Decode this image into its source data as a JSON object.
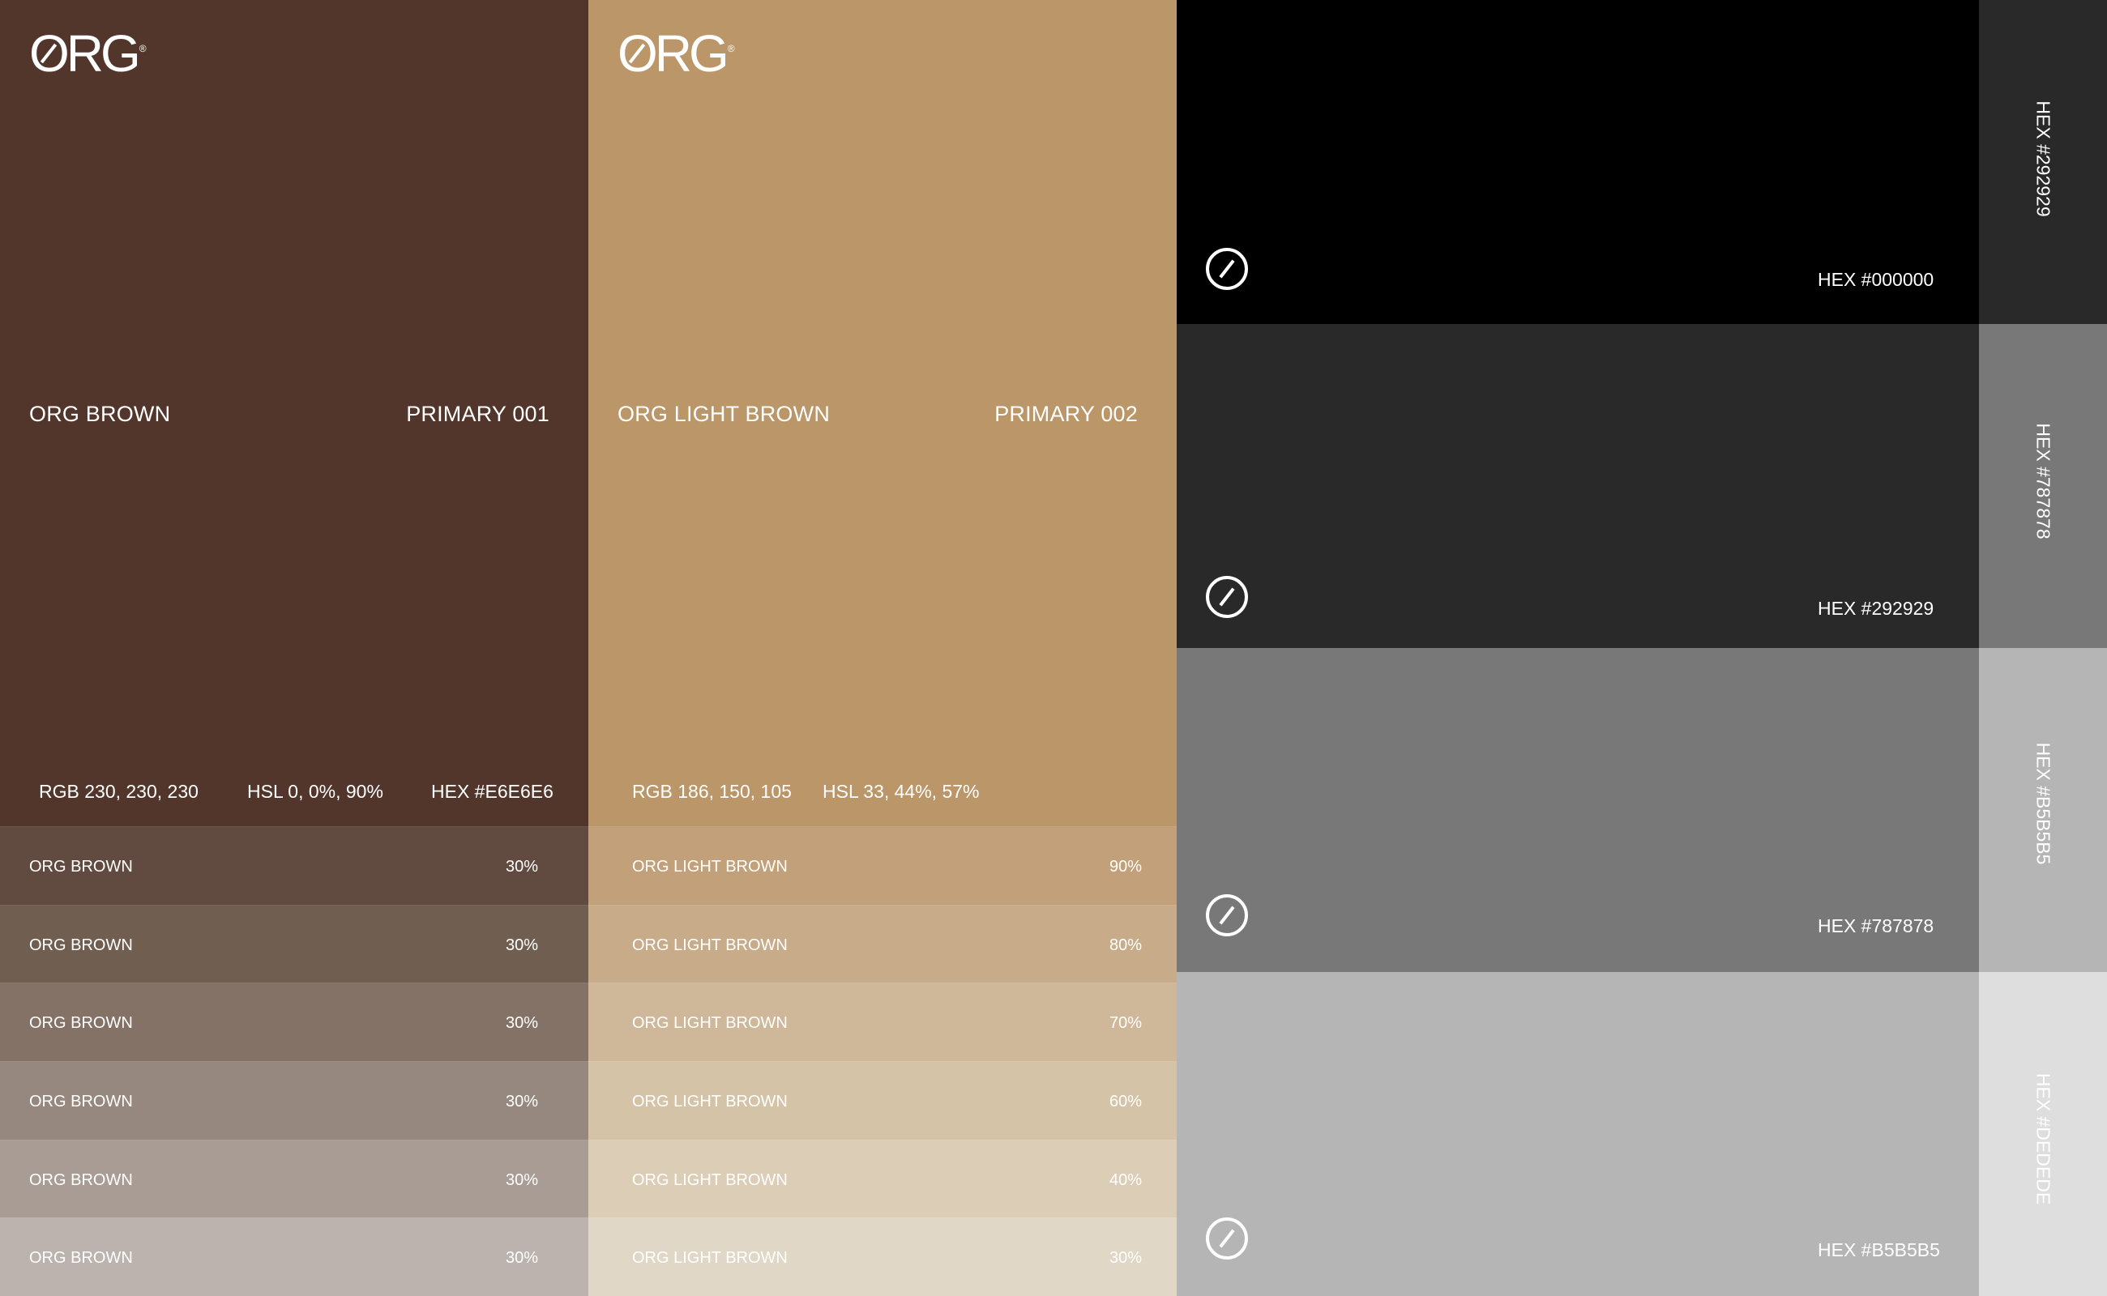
{
  "brown": {
    "logo_text": "ORG",
    "name": "ORG BROWN",
    "primary": "PRIMARY 001",
    "rgb": "RGB 230, 230, 230",
    "hsl": "HSL 0, 0%, 90%",
    "hex": "HEX #E6E6E6",
    "color": "#52362B",
    "tints": [
      {
        "label": "ORG BROWN",
        "pct": "30%",
        "color": "#614A3F"
      },
      {
        "label": "ORG BROWN",
        "pct": "30%",
        "color": "#705F51"
      },
      {
        "label": "ORG BROWN",
        "pct": "30%",
        "color": "#847267"
      },
      {
        "label": "ORG BROWN",
        "pct": "30%",
        "color": "#96887E"
      },
      {
        "label": "ORG BROWN",
        "pct": "30%",
        "color": "#A99C95"
      },
      {
        "label": "ORG BROWN",
        "pct": "30%",
        "color": "#BCB3AE"
      }
    ]
  },
  "light": {
    "logo_text": "ORG",
    "name": "ORG LIGHT BROWN",
    "primary": "PRIMARY 002",
    "rgb": "RGB 186, 150, 105",
    "hsl": "HSL 33, 44%, 57%",
    "color": "#BA9669",
    "tints": [
      {
        "label": "ORG LIGHT BROWN",
        "pct": "90%",
        "color": "#C2A17A"
      },
      {
        "label": "ORG LIGHT BROWN",
        "pct": "80%",
        "color": "#C8AC8A"
      },
      {
        "label": "ORG LIGHT BROWN",
        "pct": "70%",
        "color": "#CFB799"
      },
      {
        "label": "ORG LIGHT BROWN",
        "pct": "60%",
        "color": "#D5C3A7"
      },
      {
        "label": "ORG LIGHT BROWN",
        "pct": "40%",
        "color": "#DCCEB6"
      },
      {
        "label": "ORG LIGHT BROWN",
        "pct": "30%",
        "color": "#E1D7C6"
      }
    ]
  },
  "grays": [
    {
      "hex": "HEX #000000",
      "color": "#000000"
    },
    {
      "hex": "HEX #292929",
      "color": "#292929"
    },
    {
      "hex": "HEX #787878",
      "color": "#787878"
    },
    {
      "hex": "HEX #B5B5B5",
      "color": "#B5B5B5"
    }
  ],
  "strip": [
    {
      "hex": "HEX #292929",
      "color": "#292929"
    },
    {
      "hex": "HEX #787878",
      "color": "#787878"
    },
    {
      "hex": "HEX #B5B5B5",
      "color": "#B5B5B5"
    },
    {
      "hex": "HEX #DEDEDE",
      "color": "#DEDEDE"
    }
  ],
  "icons": {
    "logo": "org-logo-icon",
    "swatch_mark": "slashed-circle-icon"
  }
}
